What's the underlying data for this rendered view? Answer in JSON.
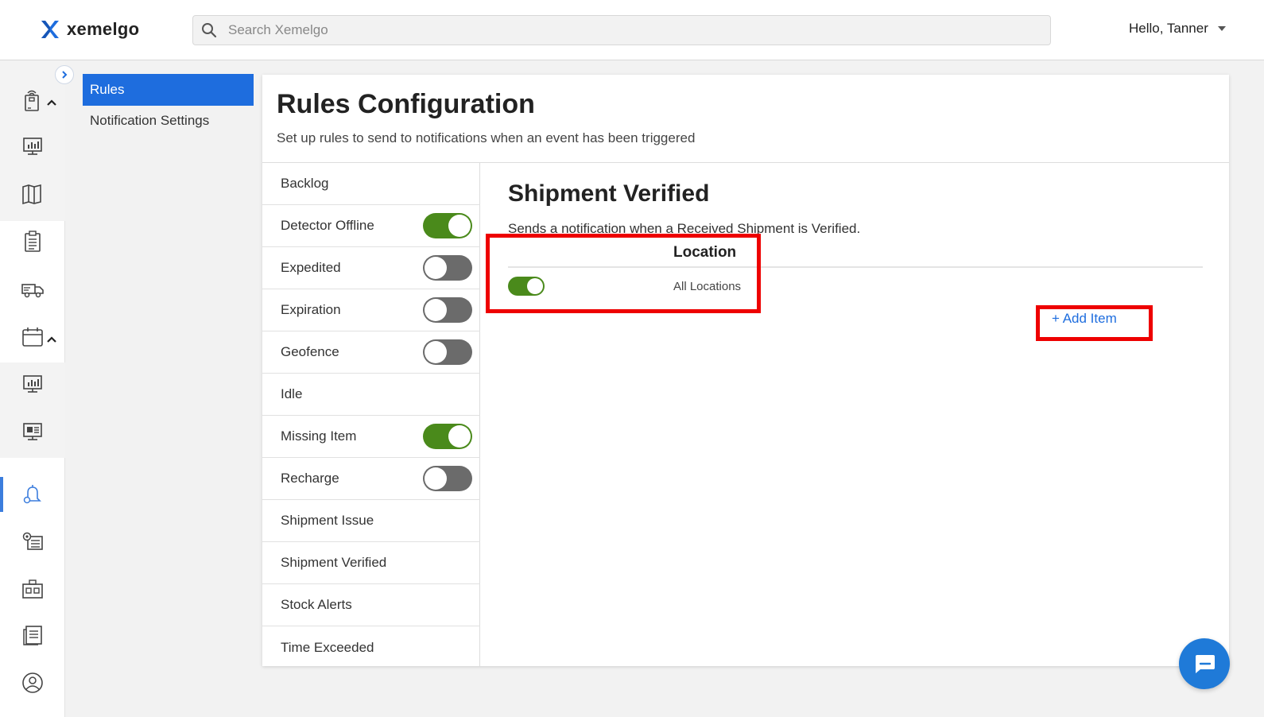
{
  "brand": {
    "name": "xemelgo",
    "color": "#1e6dde"
  },
  "search": {
    "placeholder": "Search Xemelgo"
  },
  "user": {
    "greeting": "Hello, Tanner"
  },
  "iconbar": {
    "items": [
      {
        "icon": "rfid-tag-icon",
        "expandable": true
      },
      {
        "icon": "dashboard-chart-icon"
      },
      {
        "icon": "map-icon"
      },
      {
        "icon": "clipboard-list-icon"
      },
      {
        "icon": "shipment-truck-icon"
      },
      {
        "icon": "calendar-icon",
        "expandable": true
      },
      {
        "icon": "monitor-chart-icon"
      },
      {
        "icon": "monitor-report-icon"
      },
      {
        "icon": "alert-bell-icon",
        "active": true
      },
      {
        "icon": "settings-list-icon"
      },
      {
        "icon": "inventory-boxes-icon"
      },
      {
        "icon": "document-list-icon"
      },
      {
        "icon": "user-profile-icon"
      }
    ]
  },
  "submenu": {
    "items": [
      {
        "label": "Rules",
        "active": true
      },
      {
        "label": "Notification Settings"
      }
    ]
  },
  "page": {
    "title": "Rules Configuration",
    "subtitle": "Set up rules to send to notifications when an event has been triggered"
  },
  "rules": [
    {
      "label": "Backlog"
    },
    {
      "label": "Detector Offline",
      "toggle": true,
      "on": true
    },
    {
      "label": "Expedited",
      "toggle": true,
      "on": false
    },
    {
      "label": "Expiration",
      "toggle": true,
      "on": false
    },
    {
      "label": "Geofence",
      "toggle": true,
      "on": false
    },
    {
      "label": "Idle"
    },
    {
      "label": "Missing Item",
      "toggle": true,
      "on": true
    },
    {
      "label": "Recharge",
      "toggle": true,
      "on": false
    },
    {
      "label": "Shipment Issue"
    },
    {
      "label": "Shipment Verified"
    },
    {
      "label": "Stock Alerts"
    },
    {
      "label": "Time Exceeded"
    }
  ],
  "detail": {
    "title": "Shipment Verified",
    "description": "Sends a notification when a Received Shipment is Verified.",
    "column_header": "Location",
    "row": {
      "location": "All Locations",
      "enabled": true
    },
    "add_item_label": "+ Add Item"
  },
  "colors": {
    "toggle_on": "#4a8a1b",
    "toggle_off": "#6b6b6b",
    "highlight": "#ee0000",
    "link": "#1e6dde"
  }
}
